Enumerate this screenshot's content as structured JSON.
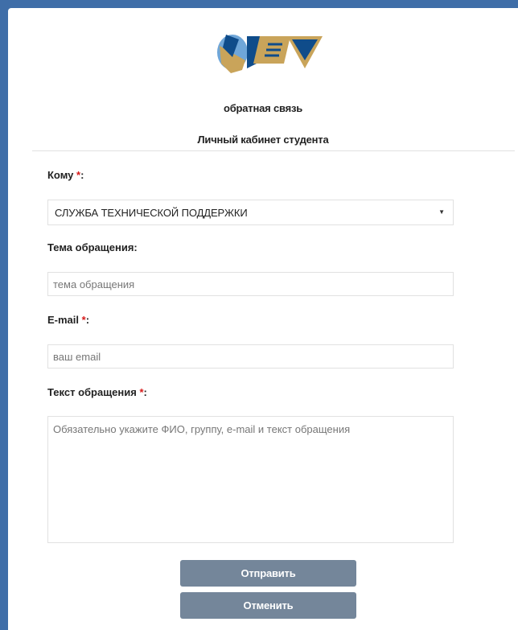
{
  "header": {
    "subtitle": "обратная связь",
    "cabinet_title": "Личный кабинет студента"
  },
  "brand_colors": {
    "navy": "#0f4c8a",
    "gold": "#c9a45a",
    "sky": "#6fa6d8"
  },
  "form": {
    "to": {
      "label": "Кому",
      "required_mark": "*",
      "colon": ":",
      "selected": "СЛУЖБА ТЕХНИЧЕСКОЙ ПОДДЕРЖКИ"
    },
    "subject": {
      "label": "Тема обращения:",
      "placeholder": "тема обращения"
    },
    "email": {
      "label": "E-mail",
      "required_mark": "*",
      "colon": ":",
      "placeholder": "ваш email"
    },
    "message": {
      "label": "Текст обращения",
      "required_mark": "*",
      "colon": ":",
      "placeholder": "Обязательно укажите ФИО, группу, e-mail и текст обращения"
    }
  },
  "buttons": {
    "submit": "Отправить",
    "cancel": "Отменить"
  }
}
